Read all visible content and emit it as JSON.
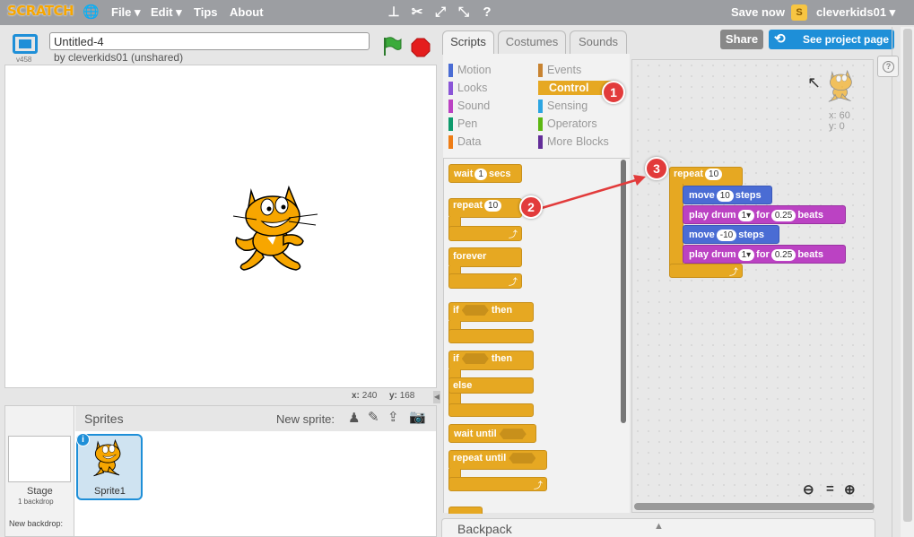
{
  "menubar": {
    "logo": "SCRATCH",
    "menus": [
      "File ▾",
      "Edit ▾",
      "Tips",
      "About"
    ],
    "save_now": "Save now",
    "username": "cleverkids01 ▾"
  },
  "project": {
    "title_value": "Untitled-4",
    "owner": "by cleverkids01 (unshared)",
    "version": "v458"
  },
  "stage_coords": {
    "x_label": "x:",
    "x_val": "240",
    "y_label": "y:",
    "y_val": "168"
  },
  "tabs": [
    "Scripts",
    "Costumes",
    "Sounds"
  ],
  "buttons": {
    "share": "Share",
    "see_project": "See project page"
  },
  "categories": {
    "left": [
      "Motion",
      "Looks",
      "Sound",
      "Pen",
      "Data"
    ],
    "right": [
      "Events",
      "Control",
      "Sensing",
      "Operators",
      "More Blocks"
    ],
    "colors_left": [
      "#4a6cd4",
      "#8a55d7",
      "#bb42c3",
      "#0e9a6c",
      "#ee7d16"
    ],
    "colors_right": [
      "#c88330",
      "#e6a822",
      "#2ca5e2",
      "#5cb712",
      "#632d99"
    ],
    "selected": "Control"
  },
  "palette_blocks": {
    "wait": "wait",
    "wait_val": "1",
    "secs": "secs",
    "repeat": "repeat",
    "repeat_val": "10",
    "forever": "forever",
    "if": "if",
    "then": "then",
    "else": "else",
    "wait_until": "wait until",
    "repeat_until": "repeat until"
  },
  "script": {
    "repeat": "repeat",
    "repeat_val": "10",
    "move": "move",
    "steps": "steps",
    "move1_val": "10",
    "move2_val": "-10",
    "play_drum": "play drum",
    "drum_val": "1▾",
    "for": "for",
    "beats_val": "0.25",
    "beats": "beats"
  },
  "sprite_pos": {
    "x": "x: 60",
    "y": "y: 0"
  },
  "badges": [
    "1",
    "2",
    "3"
  ],
  "sprites_panel": {
    "title": "Sprites",
    "new_sprite": "New sprite:",
    "stage_label": "Stage",
    "backdrop_count": "1 backdrop",
    "new_backdrop": "New backdrop:",
    "sprite_name": "Sprite1",
    "info": "i"
  },
  "backpack": "Backpack",
  "colors": {
    "control": "#e6a822",
    "motion": "#4a6cd4",
    "sound": "#bb42c3",
    "arrow": "#e23b3b",
    "accent": "#1e8fd8"
  }
}
